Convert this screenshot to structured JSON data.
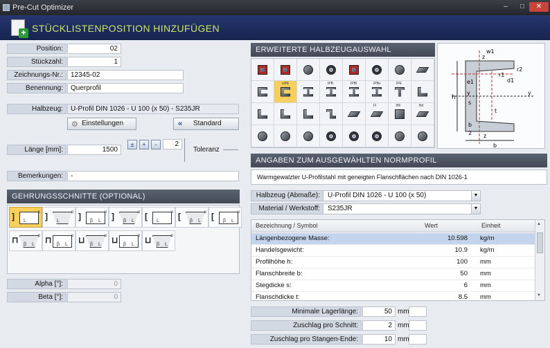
{
  "window": {
    "title": "Pre-Cut Optimizer",
    "minimize": "–",
    "maximize": "□",
    "close": "✕"
  },
  "header": {
    "title": "STÜCKLISTENPOSITION HINZUFÜGEN",
    "icon": "document-add-icon"
  },
  "form": {
    "position": {
      "label": "Position:",
      "value": "02"
    },
    "stueckzahl": {
      "label": "Stückzahl:",
      "value": "1"
    },
    "zeichnung": {
      "label": "Zeichnungs-Nr.:",
      "value": "12345-02"
    },
    "benennung": {
      "label": "Benennung:",
      "value": "Querprofil"
    },
    "halbzeug": {
      "label": "Halbzeug:",
      "value": "U-Profil DIN 1026 - U 100 (x 50) - S235JR"
    },
    "einstellungen_label": "Einstellungen",
    "standard_label": "Standard",
    "laenge": {
      "label": "Länge [mm]:",
      "value": "1500"
    },
    "tol_buttons": [
      "±",
      "+",
      "-"
    ],
    "tol_value": "2",
    "toleranz_label": "Toleranz",
    "bemerkungen": {
      "label": "Bemerkungen:",
      "value": "-"
    },
    "alpha": {
      "label": "Alpha [°]:",
      "value": "0"
    },
    "beta": {
      "label": "Beta [°]:",
      "value": "0"
    }
  },
  "sections": {
    "gehrung": "GEHRUNGSSCHNITTE (OPTIONAL)",
    "erweitert": "ERWEITERTE HALBZEUGAUSWAHL",
    "angaben": "ANGABEN ZUM AUSGEWÄHLTEN NORMPROFIL"
  },
  "profile_grid": {
    "selected_index": 9,
    "labels": [
      "",
      "",
      "",
      "",
      "",
      "",
      "",
      "",
      "",
      "UPE",
      "",
      "IPB",
      "IPBl",
      "IPBv",
      "IPE",
      "",
      "",
      "",
      "",
      "",
      "",
      "Fl",
      "Bfl",
      "Bd",
      "",
      "",
      "",
      "",
      "",
      "",
      "",
      ""
    ]
  },
  "diagram": {
    "labels": [
      "w1",
      "z",
      "r1",
      "r2",
      "e1",
      "d1",
      "h",
      "y",
      "y",
      "s",
      "t",
      "b",
      "2",
      "z",
      "b"
    ]
  },
  "info_text": "Warmgewalzter U-Profilstahl mit geneigten Flanschflächen nach DIN 1026-1",
  "halbzeug_dd": {
    "label": "Halbzeug (Abmaße):",
    "value": "U-Profil DIN 1026 - U 100 (x 50)"
  },
  "material_dd": {
    "label": "Material / Werkstoff:",
    "value": "S235JR"
  },
  "table": {
    "headers": [
      "Bezeichnung / Symbol",
      "Wert",
      "Einheit"
    ],
    "rows": [
      {
        "name": "Längenbezogene Masse:",
        "value": "10.598",
        "unit": "kg/m"
      },
      {
        "name": "Handelsgewicht:",
        "value": "10.9",
        "unit": "kg/m"
      },
      {
        "name": "Profilhöhe h:",
        "value": "100",
        "unit": "mm"
      },
      {
        "name": "Flanschbreite b:",
        "value": "50",
        "unit": "mm"
      },
      {
        "name": "Stegdicke s:",
        "value": "6",
        "unit": "mm"
      },
      {
        "name": "Flanschdicke t:",
        "value": "8.5",
        "unit": "mm"
      }
    ]
  },
  "bottom": {
    "lagerlaenge": {
      "label": "Minimale Lagerlänge:",
      "value": "50",
      "unit": "mm"
    },
    "zuschlag_schnitt": {
      "label": "Zuschlag pro Schnitt:",
      "value": "2",
      "unit": "mm"
    },
    "zuschlag_stange": {
      "label": "Zuschlag pro Stangen-Ende:",
      "value": "10",
      "unit": "mm"
    }
  },
  "miter": {
    "selected_index": 0,
    "cells": [
      {
        "bracket": "]",
        "m1": "L",
        "m2": ""
      },
      {
        "bracket": "]",
        "m1": "L",
        "m2": ""
      },
      {
        "bracket": "]",
        "m1": "β",
        "m2": "L"
      },
      {
        "bracket": "]",
        "m1": "β",
        "m2": "L"
      },
      {
        "bracket": "[",
        "m1": "L",
        "m2": ""
      },
      {
        "bracket": "[",
        "m1": "β",
        "m2": "L"
      },
      {
        "bracket": "[",
        "m1": "β",
        "m2": "L"
      },
      {
        "bracket": "⊓",
        "m1": "β",
        "m2": "L"
      },
      {
        "bracket": "⊓",
        "m1": "β",
        "m2": "L"
      },
      {
        "bracket": "⊔",
        "m1": "β",
        "m2": "L"
      },
      {
        "bracket": "⊔",
        "m1": "β",
        "m2": "L"
      },
      {
        "bracket": "⊔",
        "m1": "β",
        "m2": "L"
      }
    ],
    "alpha_mark": "α"
  }
}
